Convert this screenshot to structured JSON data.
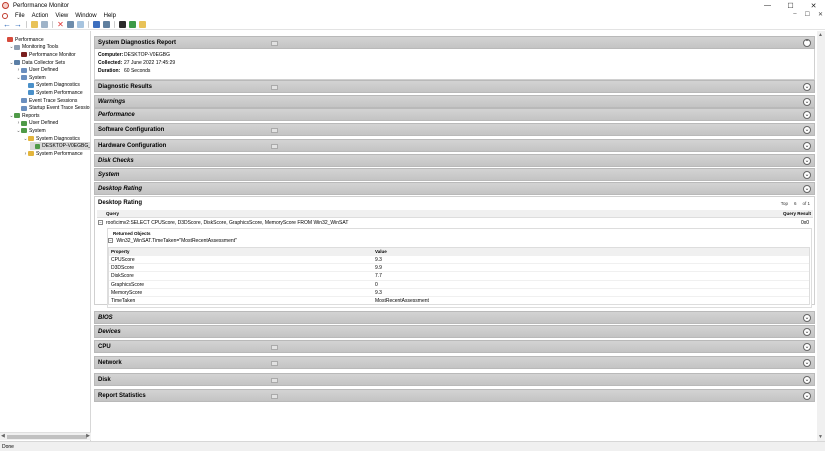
{
  "window": {
    "title": "Performance Monitor",
    "controls": {
      "minimize": "—",
      "maximize": "☐",
      "close": "✕"
    }
  },
  "menu": {
    "items": [
      "File",
      "Action",
      "View",
      "Window",
      "Help"
    ],
    "mdi_controls": [
      "–",
      "☐",
      "✕"
    ]
  },
  "toolbar": {
    "back_glyph": "←",
    "forward_glyph": "→",
    "icons": [
      "folder-icon",
      "console-icon",
      "delete-icon",
      "print-icon",
      "refresh-icon",
      "help-icon",
      "properties-icon",
      "monitor-icon",
      "collector-icon",
      "report-icon"
    ]
  },
  "tree": {
    "items": [
      {
        "label": "Performance",
        "depth": 0,
        "chev": "",
        "color": "#d64b3c"
      },
      {
        "label": "Monitoring Tools",
        "depth": 1,
        "chev": "⌄",
        "color": "#8d9db0"
      },
      {
        "label": "Performance Monitor",
        "depth": 2,
        "chev": "",
        "color": "#7a1f1f"
      },
      {
        "label": "Data Collector Sets",
        "depth": 1,
        "chev": "⌄",
        "color": "#5b7fa6"
      },
      {
        "label": "User Defined",
        "depth": 2,
        "chev": "›",
        "color": "#6b8fbf"
      },
      {
        "label": "System",
        "depth": 2,
        "chev": "⌄",
        "color": "#6b8fbf"
      },
      {
        "label": "System Diagnostics",
        "depth": 3,
        "chev": "",
        "color": "#4a90c9"
      },
      {
        "label": "System Performance",
        "depth": 3,
        "chev": "",
        "color": "#4a90c9"
      },
      {
        "label": "Event Trace Sessions",
        "depth": 2,
        "chev": "",
        "color": "#6b8fbf"
      },
      {
        "label": "Startup Event Trace Sessions",
        "depth": 2,
        "chev": "",
        "color": "#6b8fbf"
      },
      {
        "label": "Reports",
        "depth": 1,
        "chev": "⌄",
        "color": "#4f9a48"
      },
      {
        "label": "User Defined",
        "depth": 2,
        "chev": "›",
        "color": "#4f9a48"
      },
      {
        "label": "System",
        "depth": 2,
        "chev": "⌄",
        "color": "#4f9a48"
      },
      {
        "label": "System Diagnostics",
        "depth": 3,
        "chev": "⌄",
        "color": "#e3b53c"
      },
      {
        "label": "DESKTOP-V0EGBG_",
        "depth": 4,
        "chev": "",
        "color": "#4f9a48",
        "selected": true
      },
      {
        "label": "System Performance",
        "depth": 3,
        "chev": "›",
        "color": "#e3b53c"
      }
    ]
  },
  "report": {
    "header_title": "System Diagnostics Report",
    "computer_label": "Computer:",
    "computer_value": "DESKTOP-V0EGBG",
    "collected_label": "Collected:",
    "collected_value": "27 June 2022 17:45:29",
    "duration_label": "Duration:",
    "duration_value": "60 Seconds",
    "toggle_collapse": "⌃",
    "toggle_expand": "⌄"
  },
  "sections_top": [
    {
      "title": "Diagnostic Results",
      "italic": false,
      "box": true
    },
    {
      "title": "Warnings",
      "italic": true,
      "box": false
    },
    {
      "title": "Performance",
      "italic": true,
      "box": false
    },
    {
      "title": "Software Configuration",
      "italic": false,
      "box": true
    },
    {
      "title": "Hardware Configuration",
      "italic": false,
      "box": true
    },
    {
      "title": "Disk Checks",
      "italic": true,
      "box": false
    },
    {
      "title": "System",
      "italic": true,
      "box": false
    },
    {
      "title": "Desktop Rating",
      "italic": true,
      "box": false
    }
  ],
  "desktop_rating": {
    "title": "Desktop Rating",
    "top_label": "Top",
    "top_value": "6",
    "page_label": "of 1",
    "query_header": "Query",
    "result_header": "Query Result",
    "query_text": "root\\cimv2:SELECT CPUScore, D3DScore, DiskScore, GraphicsScore, MemoryScore FROM Win32_WinSAT",
    "query_result": "0x0",
    "returned_title": "Returned Objects",
    "object_text": "Win32_WinSAT.TimeTaken=\"MostRecentAssessment\"",
    "prop_header": "Property",
    "value_header": "Value",
    "properties": [
      {
        "name": "CPUScore",
        "value": "9.3"
      },
      {
        "name": "D3DScore",
        "value": "9.9"
      },
      {
        "name": "DiskScore",
        "value": "7.7"
      },
      {
        "name": "GraphicsScore",
        "value": "0"
      },
      {
        "name": "MemoryScore",
        "value": "9.3"
      },
      {
        "name": "TimeTaken",
        "value": "MostRecentAssessment"
      }
    ]
  },
  "sections_bottom": [
    {
      "title": "BIOS",
      "italic": true,
      "box": false
    },
    {
      "title": "Devices",
      "italic": true,
      "box": false
    },
    {
      "title": "CPU",
      "italic": false,
      "box": true
    },
    {
      "title": "Network",
      "italic": false,
      "box": true
    },
    {
      "title": "Disk",
      "italic": false,
      "box": true
    },
    {
      "title": "Report Statistics",
      "italic": false,
      "box": true
    }
  ],
  "status": {
    "text": "Done"
  },
  "scroll": {
    "up": "▲",
    "down": "▼",
    "left": "◀",
    "right": "▶"
  }
}
